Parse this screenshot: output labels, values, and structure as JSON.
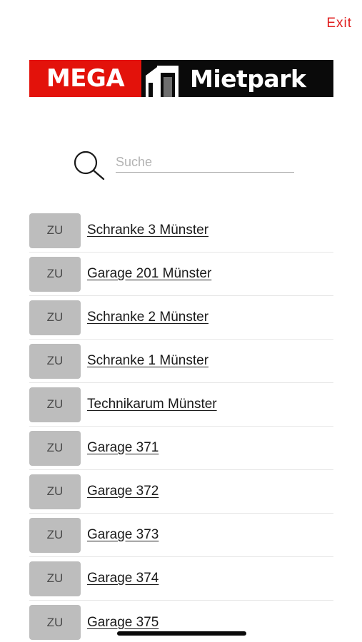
{
  "header": {
    "exit_label": "Exit"
  },
  "logo": {
    "left_text": "MEGA",
    "right_text": "Mietpark",
    "colors": {
      "red": "#e3120b",
      "black": "#0a0a0a"
    }
  },
  "search": {
    "placeholder": "Suche",
    "value": ""
  },
  "devices": [
    {
      "button": "ZU",
      "name": "Schranke 3 Münster"
    },
    {
      "button": "ZU",
      "name": "Garage 201 Münster"
    },
    {
      "button": "ZU",
      "name": "Schranke 2 Münster"
    },
    {
      "button": "ZU",
      "name": "Schranke 1 Münster"
    },
    {
      "button": "ZU",
      "name": "Technikarum Münster"
    },
    {
      "button": "ZU",
      "name": "Garage 371"
    },
    {
      "button": "ZU",
      "name": "Garage 372"
    },
    {
      "button": "ZU",
      "name": "Garage 373"
    },
    {
      "button": "ZU",
      "name": "Garage 374"
    },
    {
      "button": "ZU",
      "name": "Garage 375"
    }
  ],
  "theme": {
    "accent": "#e02020",
    "button_bg": "#bdbdbd"
  }
}
